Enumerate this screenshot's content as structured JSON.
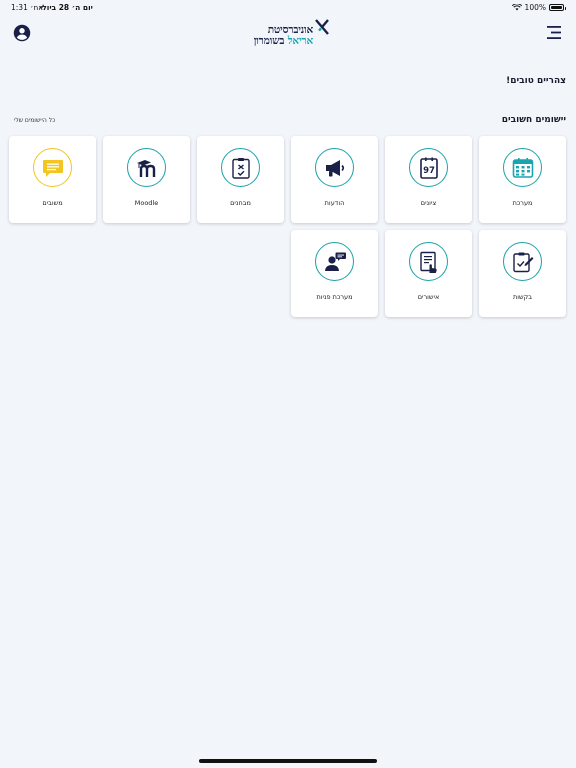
{
  "status_bar": {
    "time": "1:31 אח׳",
    "date": "יום ה׳ 28 ביולי",
    "battery": "100%"
  },
  "header": {
    "logo_line1": "אוניברסיטת",
    "logo_line2_teal": "אריאל",
    "logo_line2_navy": "בשומרון",
    "profile_icon": "user-circle-icon",
    "menu_icon": "hamburger-menu-icon"
  },
  "greeting": "צהריים טובים!",
  "apps_section": {
    "title": "יישומים חשובים",
    "all_link": "כל היישומים שלי"
  },
  "apps": [
    {
      "label": "מערכת",
      "icon": "calendar-icon"
    },
    {
      "label": "ציונים",
      "icon": "grades-97-icon",
      "icon_text": "97"
    },
    {
      "label": "הודעות",
      "icon": "megaphone-icon"
    },
    {
      "label": "מבחנים",
      "icon": "exam-clipboard-icon"
    },
    {
      "label": "Moodle",
      "icon": "moodle-icon"
    },
    {
      "label": "משובים",
      "icon": "feedback-chat-icon"
    },
    {
      "label": "בקשות",
      "icon": "request-pen-clipboard-icon"
    },
    {
      "label": "אישורים",
      "icon": "approvals-document-icon"
    },
    {
      "label": "מערכת פניות",
      "icon": "inquiries-person-chat-icon"
    }
  ],
  "colors": {
    "background": "#f2f6fa",
    "accent_teal": "#1ca3a8",
    "navy": "#1b2048",
    "feedback_yellow": "#f2c61f"
  }
}
